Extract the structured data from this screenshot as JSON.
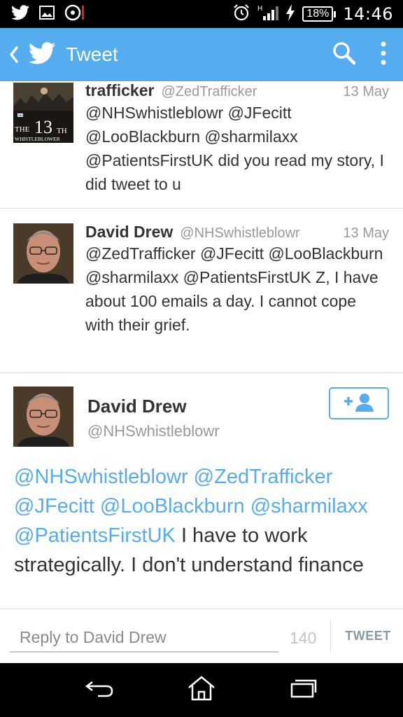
{
  "status_bar": {
    "time": "14:46",
    "battery": "18%",
    "network": "H",
    "icons": [
      "twitter-icon",
      "gallery-icon",
      "media-icon",
      "alarm-icon",
      "signal-icon",
      "charging-icon",
      "battery-icon"
    ]
  },
  "app_bar": {
    "title": "Tweet",
    "icons": [
      "back-chevron-icon",
      "twitter-bird-icon",
      "search-icon",
      "overflow-menu-icon"
    ],
    "color": "#55acee"
  },
  "timeline": [
    {
      "name": "trafficker",
      "handle": "@ZedTrafficker",
      "date": "13 May",
      "text": "@NHSwhistleblowr @JFecitt @LooBlackburn @sharmilaxx @PatientsFirstUK did you read my story, I did tweet to u",
      "avatar": {
        "big": "13",
        "small": "TH",
        "line1": "THE",
        "line2": "WHISTLEBLOWER",
        "badge": "NHS"
      }
    },
    {
      "name": "David Drew",
      "handle": "@NHSwhistleblowr",
      "date": "13 May",
      "text": "@ZedTrafficker @JFecitt @LooBlackburn @sharmilaxx @PatientsFirstUK Z, I have about 100 emails a day. I cannot cope with their grief."
    }
  ],
  "detail": {
    "name": "David Drew",
    "handle": "@NHSwhistleblowr",
    "mentions": "@NHSwhistleblowr @ZedTrafficker @JFecitt @LooBlackburn @sharmilaxx @PatientsFirstUK",
    "body": " I have to work strategically. I don't understand finance",
    "follow_icon": "add-user-icon"
  },
  "reply": {
    "placeholder": "Reply to David Drew",
    "char_count": "140",
    "button_label": "TWEET"
  },
  "nav_bar": {
    "icons": [
      "back-icon",
      "home-icon",
      "recent-apps-icon"
    ]
  }
}
